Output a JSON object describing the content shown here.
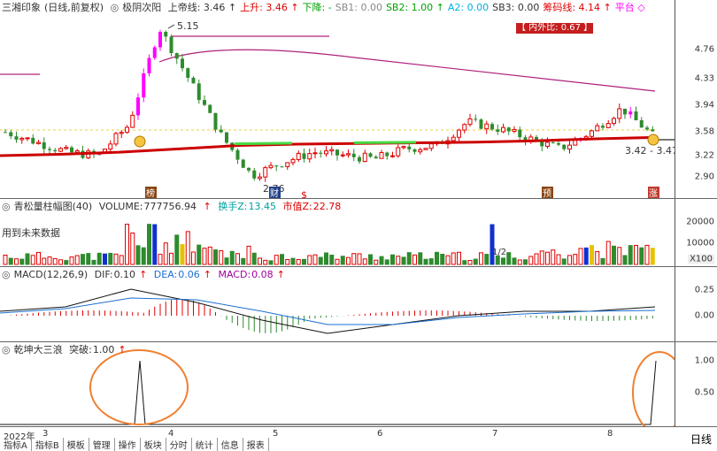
{
  "main_panel": {
    "stock_name": "三湘印象",
    "period_label": "(日线,前复权)",
    "indicator_name": "极阴次阳",
    "fields": [
      {
        "label": "上帝线:",
        "value": "3.46",
        "color": "#333333",
        "arrow": "↑"
      },
      {
        "label": "上升:",
        "value": "3.46",
        "color": "#e00000",
        "arrow": "↑"
      },
      {
        "label": "下降:",
        "value": "-",
        "color": "#00a000",
        "arrow": ""
      },
      {
        "label": "SB1:",
        "value": "0.00",
        "color": "#888888",
        "arrow": ""
      },
      {
        "label": "SB2:",
        "value": "1.00",
        "color": "#00a000",
        "arrow": "↑"
      },
      {
        "label": "A2:",
        "value": "0.00",
        "color": "#00b0e0",
        "arrow": ""
      },
      {
        "label": "SB3:",
        "value": "0.00",
        "color": "#333333",
        "arrow": ""
      },
      {
        "label": "筹码线:",
        "value": "4.14",
        "color": "#e00000",
        "arrow": "↑"
      },
      {
        "label": "平台",
        "value": "",
        "color": "#ff00ff",
        "arrow": "◇"
      }
    ],
    "ratio_badge": "【 内外比: 0.67 】",
    "price_axis": [
      "4.76",
      "4.33",
      "3.94",
      "3.58",
      "3.22",
      "2.90"
    ],
    "peak_label": "5.15",
    "low_label": "2.76",
    "range_label": "3.42 - 3.47",
    "markers": [
      "榜",
      "$",
      "预",
      "涨"
    ]
  },
  "volume_panel": {
    "title": "青松量柱幅图(40)",
    "volume_label": "VOLUME:",
    "volume_value": "777756.94",
    "turnover_label": "换手Z:",
    "turnover_value": "13.45",
    "mktcap_label": "市值Z:",
    "mktcap_value": "22.78",
    "note": "用到未来数据",
    "axis": [
      "20000",
      "10000"
    ],
    "unit": "X100",
    "annotation": "1/2"
  },
  "macd_panel": {
    "title": "MACD(12,26,9)",
    "dif_label": "DIF:",
    "dif_value": "0.10",
    "dea_label": "DEA:",
    "dea_value": "0.06",
    "macd_label": "MACD:",
    "macd_value": "0.08",
    "axis": [
      "0.25",
      "0.00"
    ]
  },
  "wave_panel": {
    "title": "乾坤大三浪",
    "signal_label": "突破:",
    "signal_value": "1.00",
    "axis": [
      "1.00",
      "0.50"
    ]
  },
  "bottom": {
    "dates": [
      "2022年",
      "3",
      "4",
      "5",
      "6",
      "7",
      "8"
    ],
    "tabs": [
      "指标A",
      "指标B",
      "模板",
      "管理",
      "操作",
      "板块",
      "分时",
      "统计",
      "信息",
      "报表"
    ],
    "period": "日线"
  },
  "colors": {
    "up": "#e00000",
    "down": "#2e8b2e",
    "magenta": "#ff00ff",
    "ma": "#cc0000",
    "purple_line": "#b0207a",
    "circle": "#f08030"
  },
  "chart_data": [
    {
      "type": "candlestick",
      "title": "三湘印象 (日线,前复权)",
      "ylim": [
        2.7,
        5.25
      ],
      "x": [
        "2022-03",
        "2022-04",
        "2022-05",
        "2022-06",
        "2022-07",
        "2022-08"
      ],
      "close_trend": [
        3.55,
        3.4,
        3.25,
        3.2,
        3.65,
        5.1,
        4.3,
        3.5,
        2.9,
        3.1,
        3.25,
        3.2,
        3.15,
        3.3,
        3.35,
        3.7,
        3.6,
        3.45,
        3.3,
        3.55,
        3.9,
        3.5
      ],
      "ma_line": [
        3.2,
        3.22,
        3.25,
        3.3,
        3.35,
        3.37,
        3.38,
        3.39,
        3.4,
        3.42,
        3.45,
        3.47
      ]
    },
    {
      "type": "bar",
      "title": "青松量柱幅图(40)",
      "ylim": [
        0,
        25000
      ]
    },
    {
      "type": "line",
      "title": "MACD(12,26,9)",
      "series": [
        {
          "name": "DIF",
          "values": [
            0.05,
            0.1,
            0.3,
            0.15,
            -0.05,
            -0.2,
            -0.1,
            0.0,
            0.05,
            0.05,
            0.1
          ]
        },
        {
          "name": "DEA",
          "values": [
            0.03,
            0.08,
            0.2,
            0.18,
            0.05,
            -0.1,
            -0.1,
            -0.02,
            0.02,
            0.05,
            0.06
          ]
        }
      ]
    },
    {
      "type": "line",
      "title": "乾坤大三浪",
      "ylim": [
        0,
        1
      ],
      "series": [
        {
          "name": "突破",
          "values": [
            0,
            1,
            0,
            0,
            0,
            0,
            1
          ]
        }
      ]
    }
  ]
}
